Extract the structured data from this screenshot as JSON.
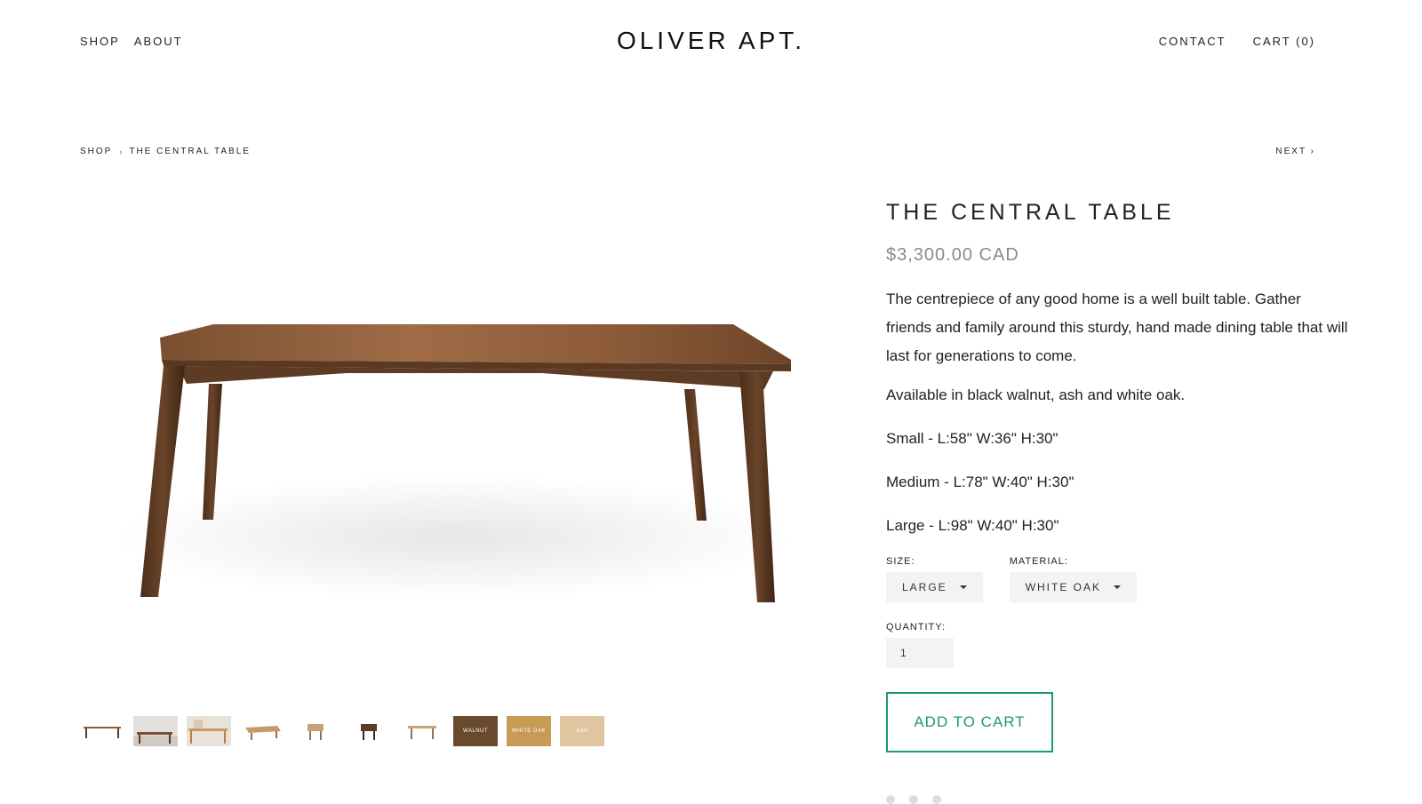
{
  "header": {
    "nav_left": [
      "SHOP",
      "ABOUT"
    ],
    "logo": "OLIVER APT.",
    "contact": "CONTACT",
    "cart": "CART (0)"
  },
  "breadcrumb": {
    "shop": "SHOP",
    "separator": "›",
    "current": "THE CENTRAL TABLE",
    "next": "NEXT ›"
  },
  "product": {
    "title": "THE CENTRAL TABLE",
    "price": "$3,300.00 CAD",
    "description": "The centrepiece of any good home is a well built table. Gather friends and family around this sturdy, hand made dining table that will last for generations to come.",
    "availability": "Available in black walnut, ash and white oak.",
    "sizes": [
      "Small - L:58\" W:36\" H:30\"",
      "Medium - L:78\" W:40\" H:30\"",
      "Large - L:98\" W:40\" H:30\""
    ],
    "size_label": "SIZE:",
    "size_value": "LARGE",
    "material_label": "MATERIAL:",
    "material_value": "WHITE OAK",
    "quantity_label": "QUANTITY:",
    "quantity_value": "1",
    "add_to_cart": "ADD TO CART"
  },
  "thumbnails": [
    {
      "kind": "table-walnut"
    },
    {
      "kind": "room"
    },
    {
      "kind": "room-light"
    },
    {
      "kind": "bench"
    },
    {
      "kind": "stool"
    },
    {
      "kind": "stool-dark"
    },
    {
      "kind": "side-table"
    },
    {
      "kind": "swatch",
      "label": "WALNUT",
      "color": "#6a4a2c"
    },
    {
      "kind": "swatch",
      "label": "WHITE OAK",
      "color": "#c79b54"
    },
    {
      "kind": "swatch",
      "label": "ASH",
      "color": "#dfc6a0"
    }
  ],
  "colors": {
    "accent": "#1e9b6b",
    "price_gray": "#8a8a8a",
    "select_bg": "#f3f3f3"
  }
}
